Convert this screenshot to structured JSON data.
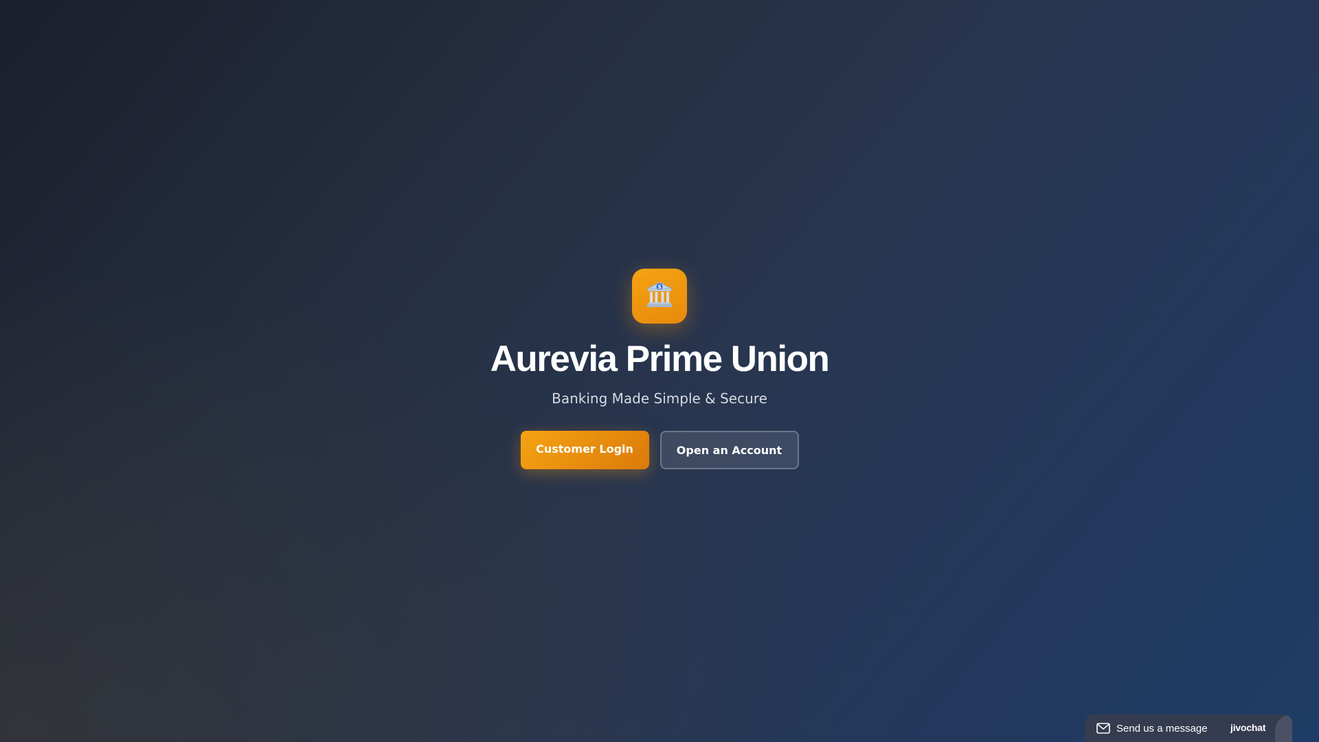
{
  "brand": {
    "logo_icon": "bank-building-icon",
    "title": "Aurevia Prime Union",
    "subtitle": "Banking Made Simple & Secure"
  },
  "actions": {
    "login_label": "Customer Login",
    "open_account_label": "Open an Account"
  },
  "chat_widget": {
    "icon": "mail-icon",
    "label": "Send us a message",
    "brand": "jivochat"
  },
  "colors": {
    "accent": "#f5a312",
    "accent_dark": "#dc7a0a",
    "background_start": "#1b1f2b",
    "background_end": "#1f3c66",
    "chat_bg": "#353c50"
  }
}
